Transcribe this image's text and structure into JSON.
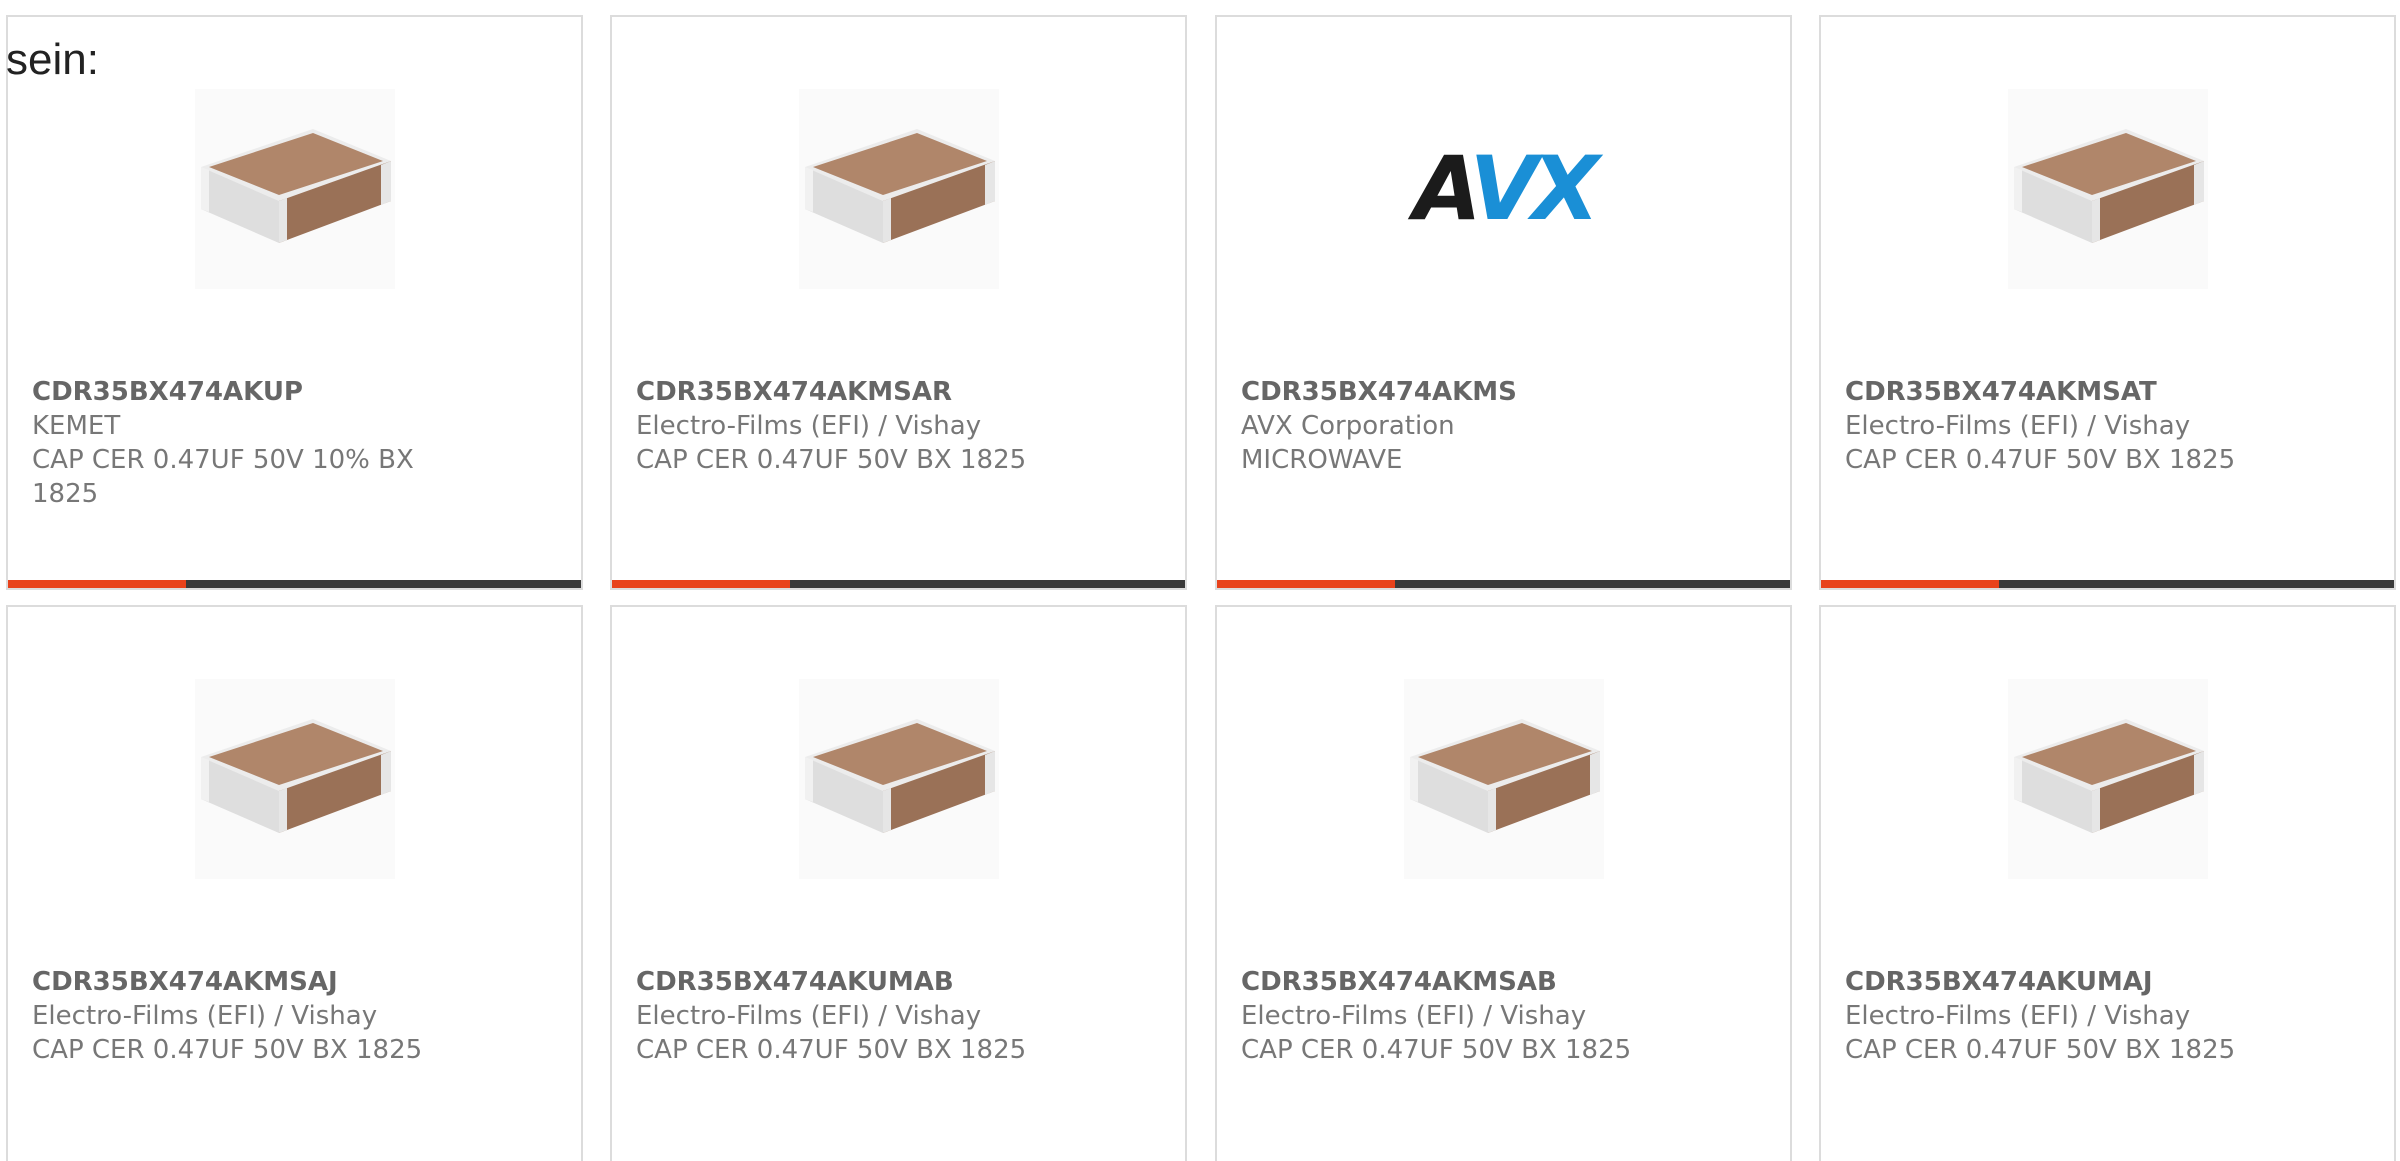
{
  "intro": {
    "text": "sein:"
  },
  "cards": [
    {
      "part": "CDR35BX474AKUP",
      "manufacturer": "KEMET",
      "description": "CAP CER 0.47UF 50V 10% BX 1825",
      "image": "chip-capacitor",
      "progress": 0.31
    },
    {
      "part": "CDR35BX474AKMSAR",
      "manufacturer": "Electro-Films (EFI) / Vishay",
      "description": "CAP CER 0.47UF 50V BX 1825",
      "image": "chip-capacitor",
      "progress": 0.31
    },
    {
      "part": "CDR35BX474AKMS",
      "manufacturer": "AVX Corporation",
      "description": "MICROWAVE",
      "image": "avx-logo",
      "logo_text": "AVX",
      "progress": 0.31
    },
    {
      "part": "CDR35BX474AKMSAT",
      "manufacturer": "Electro-Films (EFI) / Vishay",
      "description": "CAP CER 0.47UF 50V BX 1825",
      "image": "chip-capacitor",
      "progress": 0.31
    },
    {
      "part": "CDR35BX474AKMSAJ",
      "manufacturer": "Electro-Films (EFI) / Vishay",
      "description": "CAP CER 0.47UF 50V BX 1825",
      "image": "chip-capacitor"
    },
    {
      "part": "CDR35BX474AKUMAB",
      "manufacturer": "Electro-Films (EFI) / Vishay",
      "description": "CAP CER 0.47UF 50V BX 1825",
      "image": "chip-capacitor"
    },
    {
      "part": "CDR35BX474AKMSAB",
      "manufacturer": "Electro-Films (EFI) / Vishay",
      "description": "CAP CER 0.47UF 50V BX 1825",
      "image": "chip-capacitor"
    },
    {
      "part": "CDR35BX474AKUMAJ",
      "manufacturer": "Electro-Films (EFI) / Vishay",
      "description": "CAP CER 0.47UF 50V BX 1825",
      "image": "chip-capacitor"
    }
  ],
  "colors": {
    "accent": "#e8421b",
    "bar_track": "#3a3a3a",
    "border": "#dcdcdc",
    "avx_blue": "#1a8fd6",
    "avx_black": "#1b1b1b",
    "chip_top": "#b0866a",
    "chip_side": "#e3e3e3"
  }
}
